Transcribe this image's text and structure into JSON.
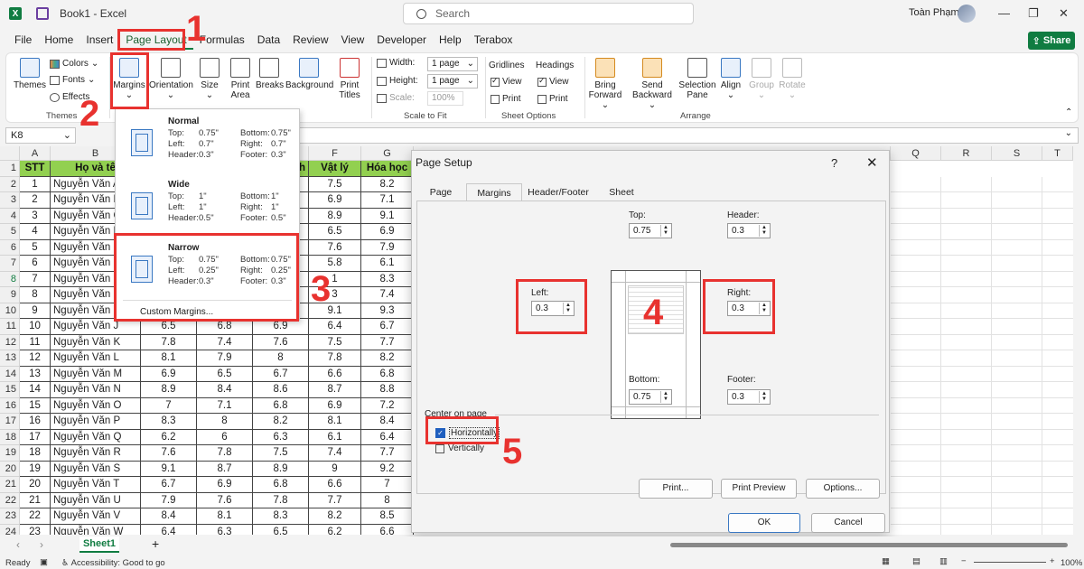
{
  "titlebar": {
    "file": "Book1",
    "app_sep": "-",
    "app": "Excel",
    "search": "Search",
    "user": "Toàn Phạm"
  },
  "menu": [
    "File",
    "Home",
    "Insert",
    "Page Layout",
    "Formulas",
    "Data",
    "Review",
    "View",
    "Developer",
    "Help",
    "Terabox"
  ],
  "share": "Share",
  "ribbon": {
    "themes": "Themes",
    "colors": "Colors",
    "fonts": "Fonts",
    "effects": "Effects",
    "margins": "Margins",
    "orientation": "Orientation",
    "size": "Size",
    "print_area_1": "Print",
    "print_area_2": "Area",
    "breaks": "Breaks",
    "background": "Background",
    "print_titles_1": "Print",
    "print_titles_2": "Titles",
    "width_lbl": "Width:",
    "width_val": "1 page",
    "height_lbl": "Height:",
    "height_val": "1 page",
    "scale_lbl": "Scale:",
    "scale_val": "100%",
    "scale_group": "Scale to Fit",
    "gridlines": "Gridlines",
    "headings": "Headings",
    "view": "View",
    "print": "Print",
    "sheet_options": "Sheet Options",
    "themes_group": "Themes",
    "bring_1": "Bring",
    "bring_2": "Forward",
    "send_1": "Send",
    "send_2": "Backward",
    "selection_1": "Selection",
    "selection_2": "Pane",
    "align": "Align",
    "group": "Group",
    "rotate": "Rotate",
    "arrange": "Arrange"
  },
  "namebox": "K8",
  "col_letters": [
    "A",
    "B",
    "F",
    "G",
    "Q",
    "R",
    "S",
    "T"
  ],
  "headers": [
    "STT",
    "Họ và tê",
    "Vật lý",
    "Hóa học"
  ],
  "partial_hdr": "h",
  "rows": [
    {
      "n": "1",
      "stt": "1",
      "name": "Nguyễn Văn A",
      "f": "7.5",
      "g": "8.2"
    },
    {
      "n": "2",
      "stt": "2",
      "name": "Nguyễn Văn B",
      "f": "6.9",
      "g": "7.1"
    },
    {
      "n": "3",
      "stt": "3",
      "name": "Nguyễn Văn C",
      "f": "8.9",
      "g": "9.1"
    },
    {
      "n": "4",
      "stt": "4",
      "name": "Nguyễn Văn D",
      "f": "6.5",
      "g": "6.9"
    },
    {
      "n": "5",
      "stt": "5",
      "name": "Nguyễn Văn E",
      "f": "7.6",
      "g": "7.9"
    },
    {
      "n": "6",
      "stt": "6",
      "name": "Nguyễn Văn F",
      "f": "5.8",
      "g": "6.1"
    },
    {
      "n": "7",
      "stt": "7",
      "name": "Nguyễn Văn G",
      "f": "1",
      "g": "8.3"
    },
    {
      "n": "8",
      "stt": "8",
      "name": "Nguyễn Văn H",
      "f": "3",
      "g": "7.4"
    },
    {
      "n": "9",
      "stt": "9",
      "name": "Nguyễn Văn I",
      "f": "9.1",
      "g": "9.3"
    },
    {
      "n": "10",
      "stt": "10",
      "name": "Nguyễn Văn J",
      "c": "6.5",
      "d": "6.8",
      "e": "6.9",
      "f": "6.4",
      "g": "6.7"
    },
    {
      "n": "11",
      "stt": "11",
      "name": "Nguyễn Văn K",
      "c": "7.8",
      "d": "7.4",
      "e": "7.6",
      "f": "7.5",
      "g": "7.7"
    },
    {
      "n": "12",
      "stt": "12",
      "name": "Nguyễn Văn L",
      "c": "8.1",
      "d": "7.9",
      "e": "8",
      "f": "7.8",
      "g": "8.2"
    },
    {
      "n": "13",
      "stt": "13",
      "name": "Nguyễn Văn M",
      "c": "6.9",
      "d": "6.5",
      "e": "6.7",
      "f": "6.6",
      "g": "6.8"
    },
    {
      "n": "14",
      "stt": "14",
      "name": "Nguyễn Văn N",
      "c": "8.9",
      "d": "8.4",
      "e": "8.6",
      "f": "8.7",
      "g": "8.8"
    },
    {
      "n": "15",
      "stt": "15",
      "name": "Nguyễn Văn O",
      "c": "7",
      "d": "7.1",
      "e": "6.8",
      "f": "6.9",
      "g": "7.2"
    },
    {
      "n": "16",
      "stt": "16",
      "name": "Nguyễn Văn P",
      "c": "8.3",
      "d": "8",
      "e": "8.2",
      "f": "8.1",
      "g": "8.4"
    },
    {
      "n": "17",
      "stt": "17",
      "name": "Nguyễn Văn Q",
      "c": "6.2",
      "d": "6",
      "e": "6.3",
      "f": "6.1",
      "g": "6.4"
    },
    {
      "n": "18",
      "stt": "18",
      "name": "Nguyễn Văn R",
      "c": "7.6",
      "d": "7.8",
      "e": "7.5",
      "f": "7.4",
      "g": "7.7"
    },
    {
      "n": "19",
      "stt": "19",
      "name": "Nguyễn Văn S",
      "c": "9.1",
      "d": "8.7",
      "e": "8.9",
      "f": "9",
      "g": "9.2"
    },
    {
      "n": "20",
      "stt": "20",
      "name": "Nguyễn Văn T",
      "c": "6.7",
      "d": "6.9",
      "e": "6.8",
      "f": "6.6",
      "g": "7"
    },
    {
      "n": "21",
      "stt": "21",
      "name": "Nguyễn Văn U",
      "c": "7.9",
      "d": "7.6",
      "e": "7.8",
      "f": "7.7",
      "g": "8"
    },
    {
      "n": "22",
      "stt": "22",
      "name": "Nguyễn Văn V",
      "c": "8.4",
      "d": "8.1",
      "e": "8.3",
      "f": "8.2",
      "g": "8.5"
    },
    {
      "n": "23",
      "stt": "23",
      "name": "Nguyễn Văn W",
      "c": "6.4",
      "d": "6.3",
      "e": "6.5",
      "f": "6.2",
      "g": "6.6"
    }
  ],
  "margins_menu": {
    "items": [
      {
        "title": "Normal",
        "top": "Top:",
        "top_v": "0.75\"",
        "bottom": "Bottom:",
        "bottom_v": "0.75\"",
        "left": "Left:",
        "left_v": "0.7\"",
        "right": "Right:",
        "right_v": "0.7\"",
        "header": "Header:",
        "header_v": "0.3\"",
        "footer": "Footer:",
        "footer_v": "0.3\""
      },
      {
        "title": "Wide",
        "top": "Top:",
        "top_v": "1\"",
        "bottom": "Bottom:",
        "bottom_v": "1\"",
        "left": "Left:",
        "left_v": "1\"",
        "right": "Right:",
        "right_v": "1\"",
        "header": "Header:",
        "header_v": "0.5\"",
        "footer": "Footer:",
        "footer_v": "0.5\""
      },
      {
        "title": "Narrow",
        "top": "Top:",
        "top_v": "0.75\"",
        "bottom": "Bottom:",
        "bottom_v": "0.75\"",
        "left": "Left:",
        "left_v": "0.25\"",
        "right": "Right:",
        "right_v": "0.25\"",
        "header": "Header:",
        "header_v": "0.3\"",
        "footer": "Footer:",
        "footer_v": "0.3\""
      }
    ],
    "custom": "Custom Margins..."
  },
  "dialog": {
    "title": "Page Setup",
    "help": "?",
    "close": "✕",
    "tabs": [
      "Page",
      "Margins",
      "Header/Footer",
      "Sheet"
    ],
    "top_lbl": "Top:",
    "top_val": "0.75",
    "header_lbl": "Header:",
    "header_val": "0.3",
    "left_lbl": "Left:",
    "left_val": "0.3",
    "right_lbl": "Right:",
    "right_val": "0.3",
    "bottom_lbl": "Bottom:",
    "bottom_val": "0.75",
    "footer_lbl": "Footer:",
    "footer_val": "0.3",
    "center_lbl": "Center on page",
    "horizontally": "Horizontally",
    "vertically": "Vertically",
    "print_btn": "Print...",
    "preview_btn": "Print Preview",
    "options_btn": "Options...",
    "ok": "OK",
    "cancel": "Cancel"
  },
  "annotations": [
    "1",
    "2",
    "3",
    "4",
    "5"
  ],
  "sheet_tab": "Sheet1",
  "add_sheet": "+",
  "status": {
    "ready": "Ready",
    "accessibility": "Accessibility: Good to go",
    "zoom": "100%"
  },
  "colors": {
    "accent": "#107c41",
    "annotation": "#e8322f",
    "header_fill": "#92d050"
  }
}
